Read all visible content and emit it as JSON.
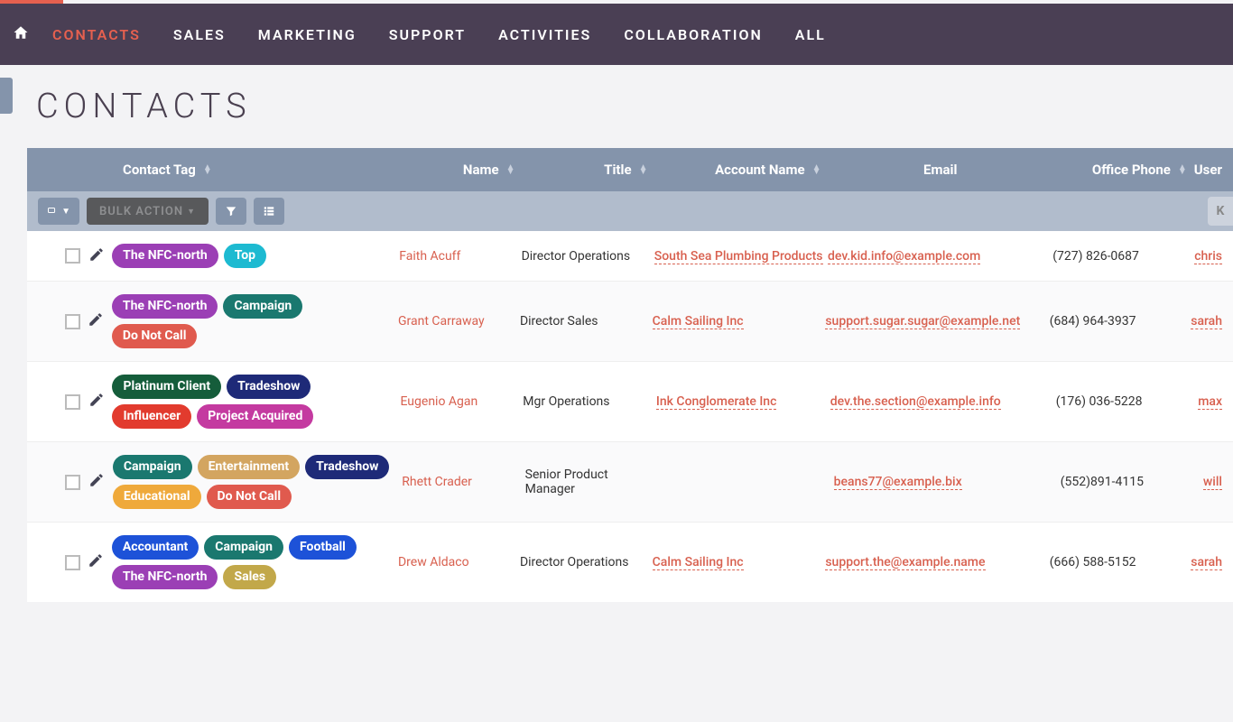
{
  "nav": {
    "items": [
      "CONTACTS",
      "SALES",
      "MARKETING",
      "SUPPORT",
      "ACTIVITIES",
      "COLLABORATION",
      "ALL"
    ],
    "active_index": 0
  },
  "page": {
    "title": "CONTACTS"
  },
  "toolbar": {
    "bulk_label": "BULK ACTION"
  },
  "columns": {
    "tag": "Contact Tag",
    "name": "Name",
    "title": "Title",
    "account": "Account Name",
    "email": "Email",
    "phone": "Office Phone",
    "user": "User"
  },
  "tag_colors": {
    "The NFC-north": "#9b3fb5",
    "Top": "#1dbad1",
    "Campaign": "#1a786f",
    "Do Not Call": "#e05a4e",
    "Platinum Client": "#155d3b",
    "Tradeshow": "#1e2a78",
    "Influencer": "#e23b2e",
    "Project Acquired": "#c43aa0",
    "Entertainment": "#d3a560",
    "Educational": "#efa93b",
    "Accountant": "#1d52d8",
    "Football": "#1d52d8",
    "Sales": "#c2a84a"
  },
  "rows": [
    {
      "tags": [
        "The NFC-north",
        "Top"
      ],
      "name": "Faith Acuff",
      "title": "Director Operations",
      "account": "South Sea Plumbing Products",
      "email": "dev.kid.info@example.com",
      "phone": "(727) 826-0687",
      "user": "chris"
    },
    {
      "tags": [
        "The NFC-north",
        "Campaign",
        "Do Not Call"
      ],
      "name": "Grant Carraway",
      "title": "Director Sales",
      "account": "Calm Sailing Inc",
      "email": "support.sugar.sugar@example.net",
      "phone": "(684) 964-3937",
      "user": "sarah"
    },
    {
      "tags": [
        "Platinum Client",
        "Tradeshow",
        "Influencer",
        "Project Acquired"
      ],
      "name": "Eugenio Agan",
      "title": "Mgr Operations",
      "account": "Ink Conglomerate Inc",
      "email": "dev.the.section@example.info",
      "phone": "(176) 036-5228",
      "user": "max"
    },
    {
      "tags": [
        "Campaign",
        "Entertainment",
        "Tradeshow",
        "Educational",
        "Do Not Call"
      ],
      "name": "Rhett Crader",
      "title": "Senior Product Manager",
      "account": "",
      "email": "beans77@example.bix",
      "phone": "(552)891-4115",
      "user": "will"
    },
    {
      "tags": [
        "Accountant",
        "Campaign",
        "Football",
        "The NFC-north",
        "Sales"
      ],
      "name": "Drew Aldaco",
      "title": "Director Operations",
      "account": "Calm Sailing Inc",
      "email": "support.the@example.name",
      "phone": "(666) 588-5152",
      "user": "sarah"
    }
  ]
}
